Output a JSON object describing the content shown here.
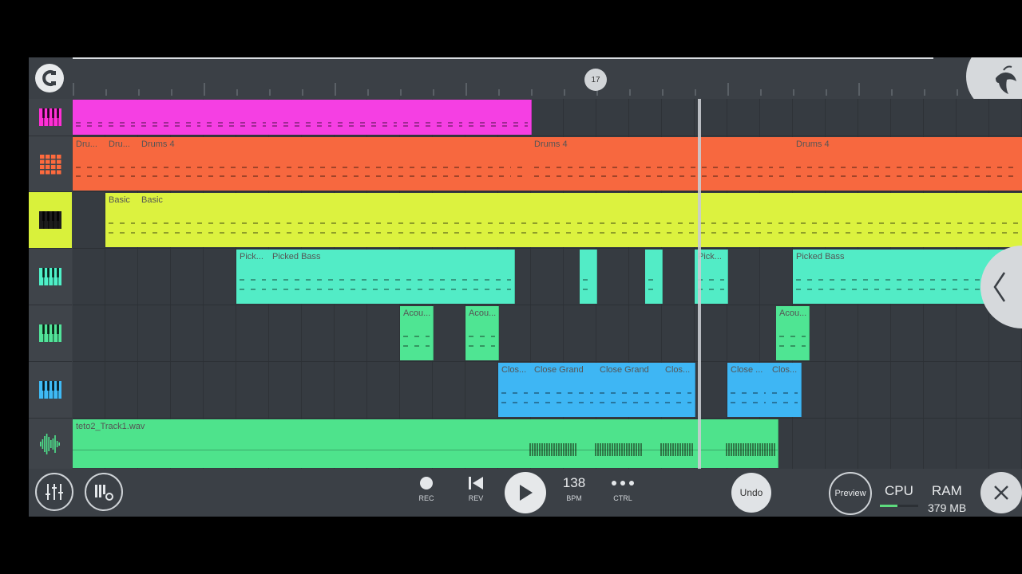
{
  "timeline": {
    "position_marker": "17"
  },
  "tracks": [
    {
      "id": "t1",
      "icon": "piano-roll-icon",
      "icon_color": "#ff2fd6",
      "clip_color": "#f53fe3",
      "clips": [
        {
          "label": ""
        },
        {
          "label": ""
        },
        {
          "label": ""
        },
        {
          "label": ""
        },
        {
          "label": ""
        },
        {
          "label": ""
        },
        {
          "label": ""
        },
        {
          "label": ""
        }
      ]
    },
    {
      "id": "t2",
      "icon": "drum-grid-icon",
      "icon_color": "#ff6a3d",
      "clip_color": "#f7683f",
      "clips": [
        {
          "label": "Dru..."
        },
        {
          "label": "Dru..."
        },
        {
          "label": "Drums 4"
        },
        {
          "label": ""
        },
        {
          "label": "Drums 4"
        },
        {
          "label": ""
        },
        {
          "label": "Drums 4"
        }
      ]
    },
    {
      "id": "t3",
      "icon": "piano-roll-icon",
      "icon_color": "#1c1c1c",
      "clip_color": "#dcf23f",
      "selected": true,
      "clips": [
        {
          "label": "Basic"
        },
        {
          "label": "Basic"
        }
      ]
    },
    {
      "id": "t4",
      "icon": "piano-roll-icon",
      "icon_color": "#4ff0c8",
      "clip_color": "#52ecc6",
      "clips": [
        {
          "label": "Pick..."
        },
        {
          "label": "Picked Bass"
        },
        {
          "label": ""
        },
        {
          "label": ""
        },
        {
          "label": "Pick..."
        },
        {
          "label": "Picked Bass"
        }
      ]
    },
    {
      "id": "t5",
      "icon": "piano-roll-icon",
      "icon_color": "#52e39a",
      "clip_color": "#4fe593",
      "clips": [
        {
          "label": "Acou..."
        },
        {
          "label": "Acou..."
        },
        {
          "label": "Acou..."
        }
      ]
    },
    {
      "id": "t6",
      "icon": "piano-roll-icon",
      "icon_color": "#3fbaf5",
      "clip_color": "#3eb6f4",
      "clips": [
        {
          "label": "Clos..."
        },
        {
          "label": "Close Grand"
        },
        {
          "label": "Close Grand"
        },
        {
          "label": "Clos..."
        },
        {
          "label": "Close ..."
        },
        {
          "label": "Clos..."
        }
      ]
    },
    {
      "id": "t7",
      "icon": "audio-waveform-icon",
      "icon_color": "#4ee38c",
      "clip_color": "#4ee38c",
      "clips": [
        {
          "label": "teto2_Track1.wav"
        }
      ]
    }
  ],
  "transport": {
    "rec_label": "REC",
    "rev_label": "REV",
    "bpm_value": "138",
    "bpm_label": "BPM",
    "ctrl_label": "CTRL",
    "undo_label": "Undo",
    "preview_label": "Preview",
    "cpu_label": "CPU",
    "cpu_level": 0.45,
    "ram_label": "RAM",
    "ram_value": "379 MB"
  }
}
